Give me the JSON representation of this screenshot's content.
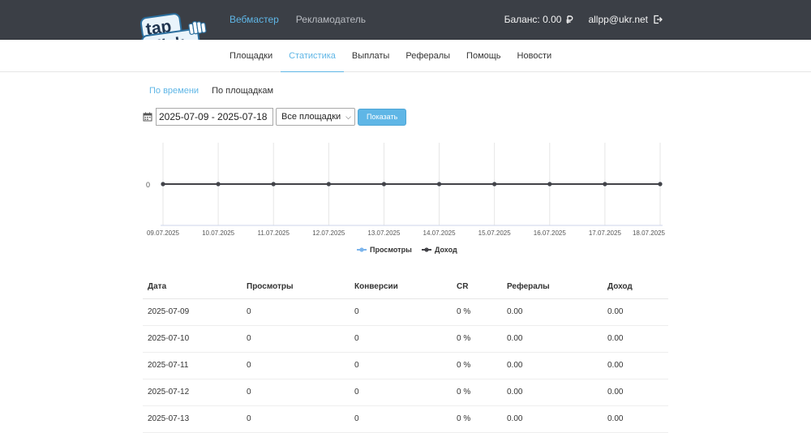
{
  "header": {
    "logo_text": "tap Click",
    "nav": [
      {
        "label": "Вебмастер",
        "active": true
      },
      {
        "label": "Рекламодатель",
        "active": false
      }
    ],
    "balance": "Баланс: 0.00",
    "currency_icon": "ruble-icon",
    "user": "allpp@ukr.net",
    "logout_icon": "logout-icon"
  },
  "subnav": [
    {
      "label": "Площадки",
      "active": false
    },
    {
      "label": "Статистика",
      "active": true
    },
    {
      "label": "Выплаты",
      "active": false
    },
    {
      "label": "Рефералы",
      "active": false
    },
    {
      "label": "Помощь",
      "active": false
    },
    {
      "label": "Новости",
      "active": false
    }
  ],
  "view_tabs": [
    {
      "label": "По времени",
      "active": true
    },
    {
      "label": "По площадкам",
      "active": false
    }
  ],
  "filters": {
    "calendar_icon": "calendar-icon",
    "date_range": "2025-07-09 - 2025-07-18",
    "platform_select": "Все площадки",
    "show_button": "Показать"
  },
  "chart_data": {
    "type": "line",
    "x": [
      "09.07.2025",
      "10.07.2025",
      "11.07.2025",
      "12.07.2025",
      "13.07.2025",
      "14.07.2025",
      "15.07.2025",
      "16.07.2025",
      "17.07.2025",
      "18.07.2025"
    ],
    "y_ticks": [
      "0"
    ],
    "series": [
      {
        "name": "Просмотры",
        "values": [
          0,
          0,
          0,
          0,
          0,
          0,
          0,
          0,
          0,
          0
        ],
        "color": "#7cb5ec"
      },
      {
        "name": "Доход",
        "values": [
          0,
          0,
          0,
          0,
          0,
          0,
          0,
          0,
          0,
          0
        ],
        "color": "#434348"
      }
    ],
    "grid": "vertical",
    "legend": "bottom-center"
  },
  "table": {
    "headers": [
      "Дата",
      "Просмотры",
      "Конверсии",
      "CR",
      "Рефералы",
      "Доход"
    ],
    "rows": [
      [
        "2025-07-09",
        "0",
        "0",
        "0 %",
        "0.00",
        "0.00"
      ],
      [
        "2025-07-10",
        "0",
        "0",
        "0 %",
        "0.00",
        "0.00"
      ],
      [
        "2025-07-11",
        "0",
        "0",
        "0 %",
        "0.00",
        "0.00"
      ],
      [
        "2025-07-12",
        "0",
        "0",
        "0 %",
        "0.00",
        "0.00"
      ],
      [
        "2025-07-13",
        "0",
        "0",
        "0 %",
        "0.00",
        "0.00"
      ]
    ]
  }
}
